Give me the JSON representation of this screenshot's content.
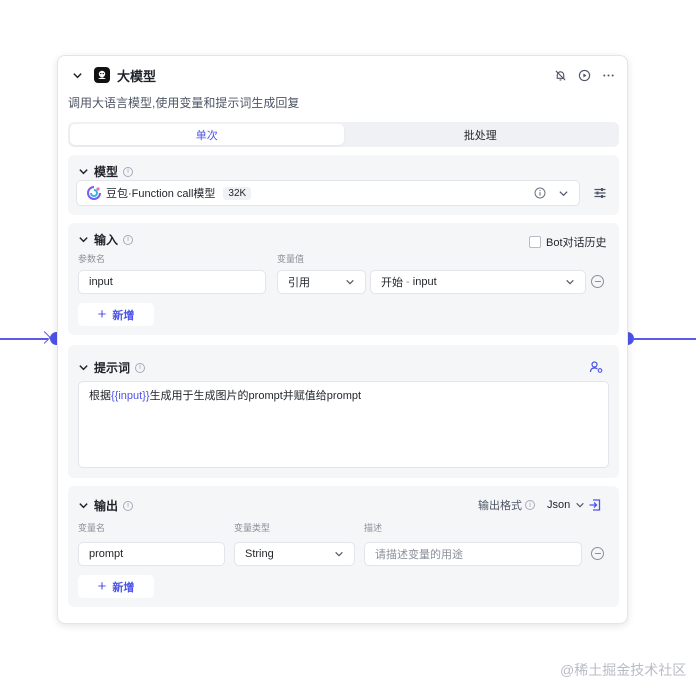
{
  "node": {
    "title": "大模型",
    "description": "调用大语言模型,使用变量和提示词生成回复",
    "tabs": [
      {
        "label": "单次",
        "active": true
      },
      {
        "label": "批处理",
        "active": false
      }
    ]
  },
  "model": {
    "title": "模型",
    "name": "豆包·Function call模型",
    "context": "32K"
  },
  "input": {
    "title": "输入",
    "bot_history_label": "Bot对话历史",
    "col_param": "参数名",
    "col_value": "变量值",
    "param_value": "input",
    "ref_type": "引用",
    "source_node": "开始",
    "source_sep": " - ",
    "source_var": "input",
    "add_label": "新增"
  },
  "prompt": {
    "title": "提示词",
    "text_before": "根据",
    "text_var": "{{input}}",
    "text_after": "生成用于生成图片的prompt并赋值给prompt"
  },
  "output": {
    "title": "输出",
    "format_label": "输出格式",
    "format_value": "Json",
    "col_name": "变量名",
    "col_type": "变量类型",
    "col_desc": "描述",
    "var_name": "prompt",
    "var_type": "String",
    "desc_placeholder": "请描述变量的用途",
    "add_label": "新增"
  },
  "watermark": "@稀土掘金技术社区",
  "colors": {
    "accent": "#4d53e8",
    "section_bg": "#f5f6f8"
  }
}
